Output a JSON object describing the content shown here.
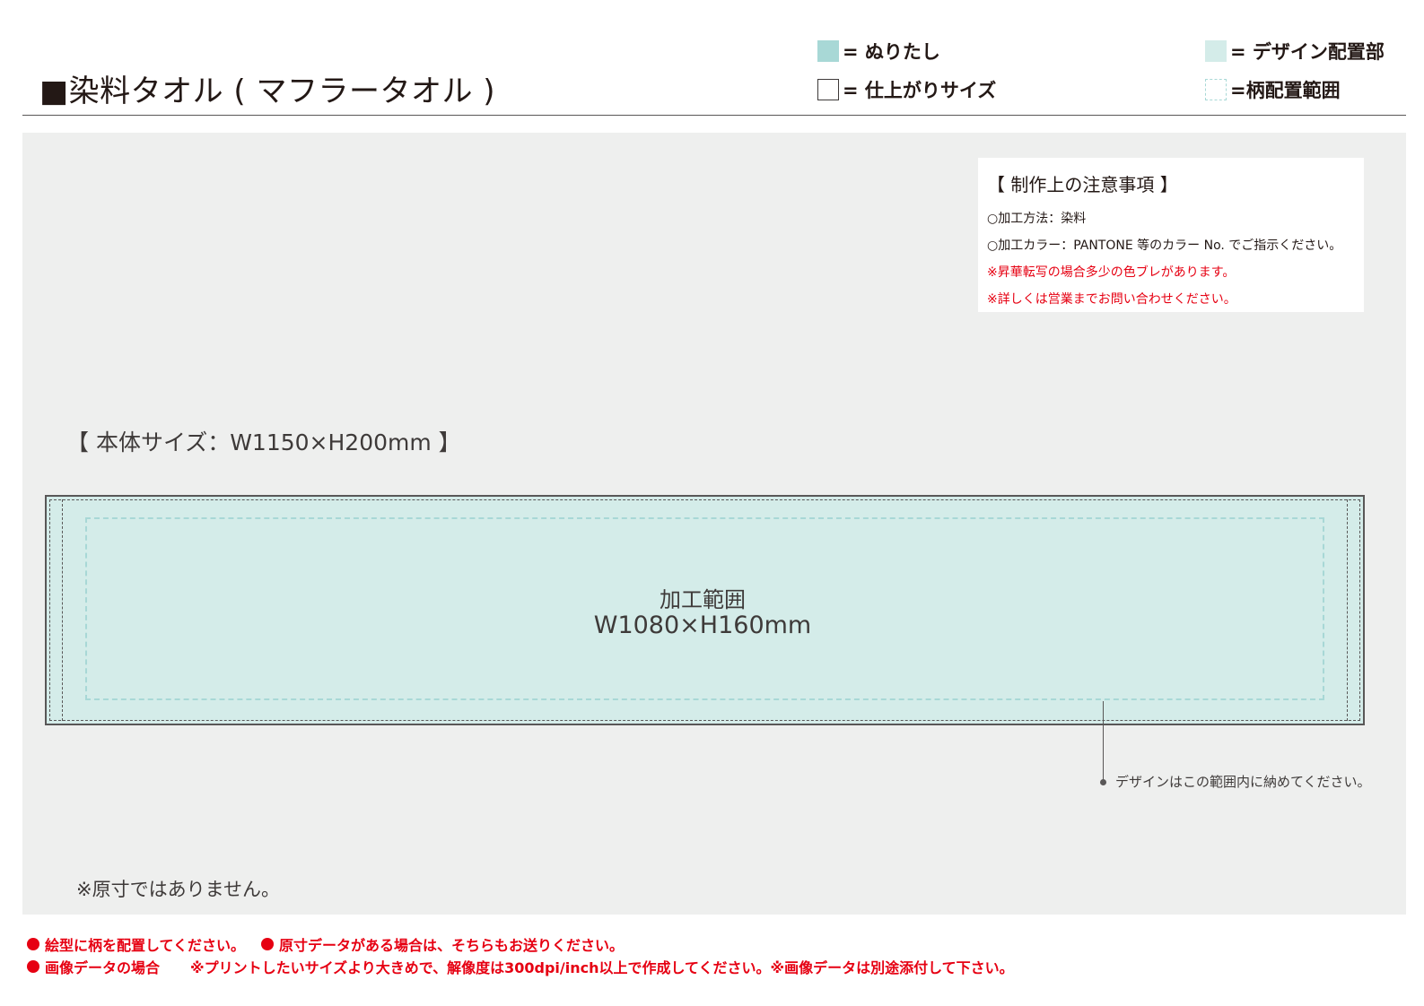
{
  "header": {
    "title": "■染料タオル ( マフラータオル )"
  },
  "legend": {
    "bleed": "= ぬりたし",
    "finish_size": "= 仕上がりサイズ",
    "design_area": "= デザイン配置部",
    "pattern_area": "=柄配置範囲"
  },
  "notes": {
    "title": "【 制作上の注意事項 】",
    "lines": [
      "○加工方法：染料",
      "○加工カラー：PANTONE 等のカラー No. でご指示ください。",
      "※昇華転写の場合多少の色ブレがあります。",
      "※詳しくは営業までお問い合わせください。"
    ]
  },
  "template": {
    "body_size": "【 本体サイズ：W1150×H200mm 】",
    "area_label": "加工範囲",
    "area_size": "W1080×H160mm",
    "leader_note": "デザインはこの範囲内に納めてください。",
    "not_actual_size": "※原寸ではありません。"
  },
  "footer": {
    "item1": "絵型に柄を配置してください。",
    "item2": "原寸データがある場合は、そちらもお送りください。",
    "item3_label": "画像データの場合",
    "item3_text": "※プリントしたいサイズより大きめで、解像度は300dpi/inch以上で作成してください。※画像データは別途添付して下さい。"
  },
  "colors": {
    "bleed": "#a8d8d6",
    "design": "#d4ece9",
    "artboard": "#eeefee",
    "warning_red": "#e60012",
    "text": "#231815"
  }
}
